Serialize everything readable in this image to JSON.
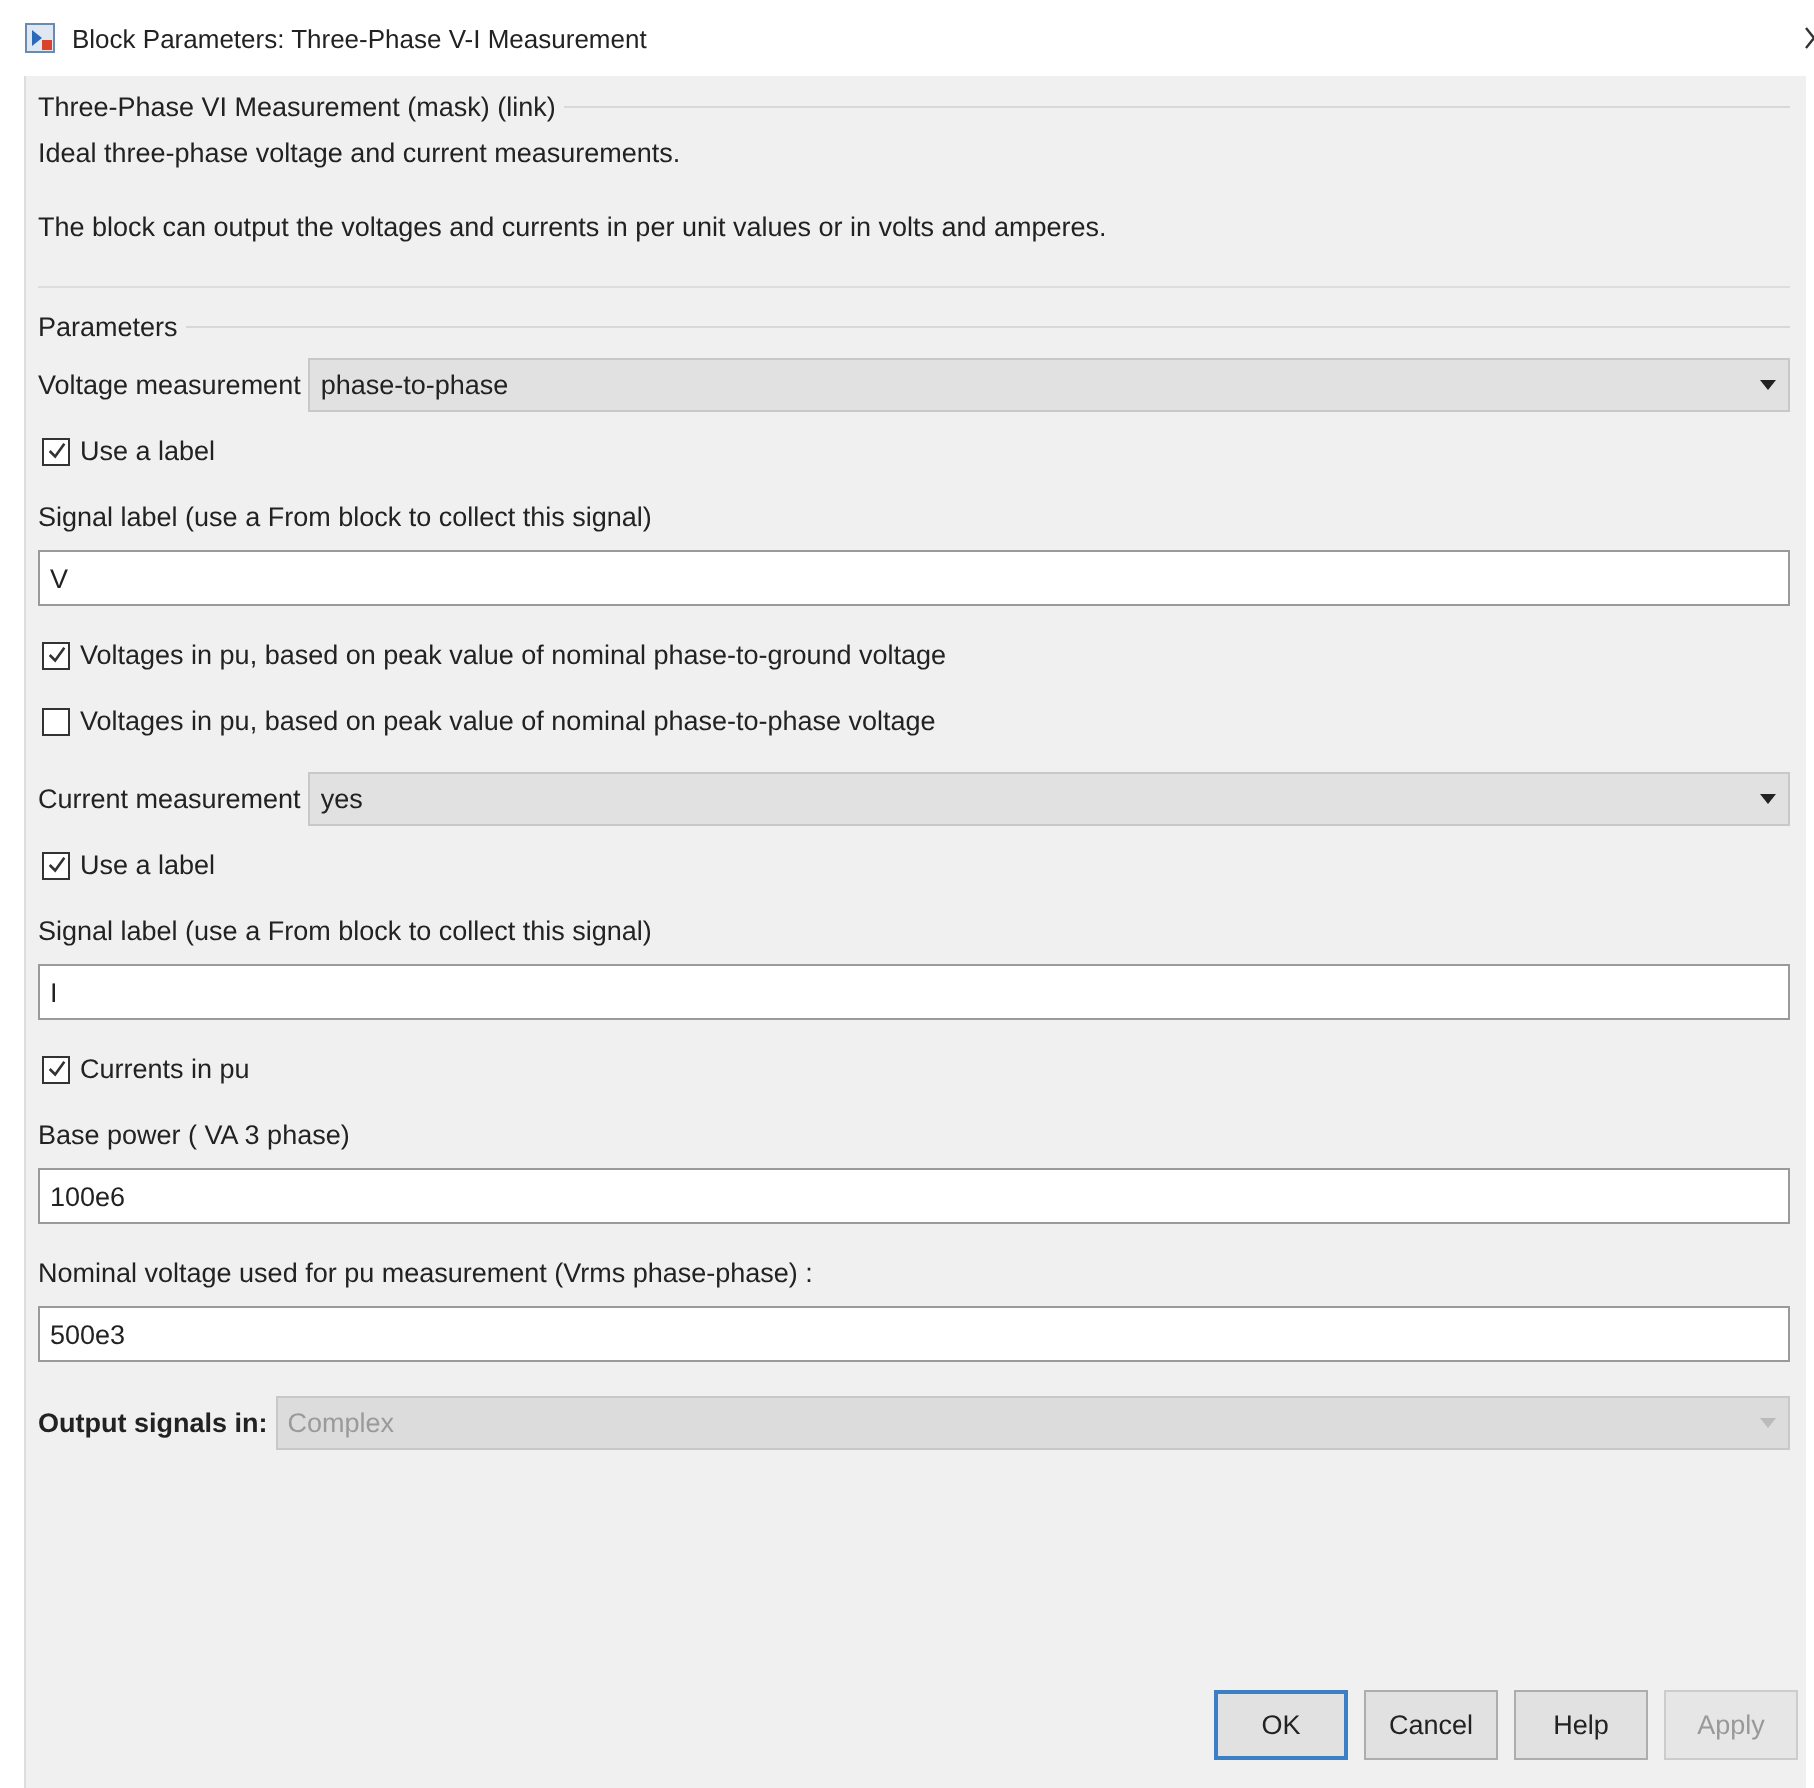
{
  "window": {
    "title": "Block Parameters: Three-Phase V-I Measurement"
  },
  "mask": {
    "title": "Three-Phase VI Measurement (mask) (link)",
    "description": [
      "Ideal three-phase voltage and current measurements.",
      "The block can output the voltages and currents in per unit values or in volts and amperes."
    ]
  },
  "parameters": {
    "title": "Parameters",
    "items": [
      {
        "kind": "dropdown",
        "label": "Voltage measurement",
        "value": "phase-to-phase",
        "disabled": false
      },
      {
        "kind": "checkbox",
        "label": "Use a label",
        "checked": true
      },
      {
        "kind": "text",
        "label": "Signal label  (use a From block to collect this signal)",
        "value": "V"
      },
      {
        "kind": "checkbox",
        "label": "Voltages in pu,  based on peak value of nominal phase-to-ground voltage",
        "checked": true
      },
      {
        "kind": "checkbox",
        "label": "Voltages in pu,  based on peak value of nominal phase-to-phase  voltage",
        "checked": false
      },
      {
        "kind": "dropdown",
        "label": "Current measurement",
        "value": "yes",
        "disabled": false
      },
      {
        "kind": "checkbox",
        "label": "Use a label",
        "checked": true
      },
      {
        "kind": "text",
        "label": "Signal label  (use a From block to collect this signal)",
        "value": "I"
      },
      {
        "kind": "checkbox",
        "label": "Currents in pu",
        "checked": true
      },
      {
        "kind": "text",
        "label": "Base power ( VA 3 phase)",
        "value": "100e6"
      },
      {
        "kind": "text",
        "label": "Nominal voltage used for pu measurement (Vrms phase-phase) :",
        "value": "500e3"
      },
      {
        "kind": "dropdown",
        "label": "Output signals in:",
        "value": "Complex",
        "disabled": true
      }
    ]
  },
  "buttons": [
    {
      "label": "OK",
      "default": true,
      "disabled": false
    },
    {
      "label": "Cancel",
      "default": false,
      "disabled": false
    },
    {
      "label": "Help",
      "default": false,
      "disabled": false
    },
    {
      "label": "Apply",
      "default": false,
      "disabled": true
    }
  ]
}
